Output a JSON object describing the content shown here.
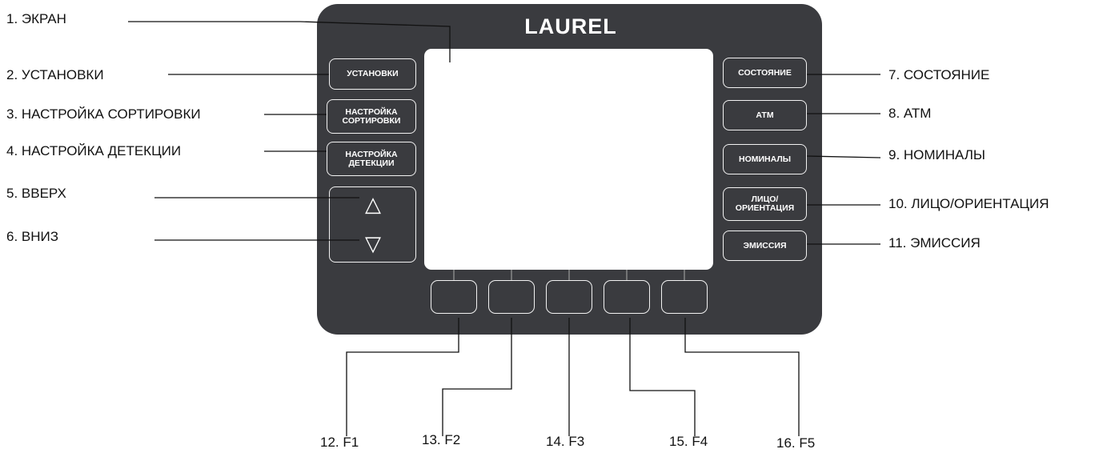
{
  "device": {
    "brand": "LAUREL",
    "left_keys": [
      {
        "id": "setup",
        "label": "УСТАНОВКИ"
      },
      {
        "id": "sort-setup",
        "label": "НАСТРОЙКА\nСОРТИРОВКИ"
      },
      {
        "id": "detect-setup",
        "label": "НАСТРОЙКА\nДЕТЕКЦИИ"
      }
    ],
    "arrows": {
      "up": "△",
      "down": "▽"
    },
    "right_keys": [
      {
        "id": "status",
        "label": "СОСТОЯНИЕ"
      },
      {
        "id": "atm",
        "label": "АТМ"
      },
      {
        "id": "denominations",
        "label": "НОМИНАЛЫ"
      },
      {
        "id": "face-orientation",
        "label": "ЛИЦО/\nОРИЕНТАЦИЯ"
      },
      {
        "id": "issue",
        "label": "ЭМИССИЯ"
      }
    ]
  },
  "callouts": [
    "1. ЭКРАН",
    "2. УСТАНОВКИ",
    "3. НАСТРОЙКА СОРТИРОВКИ",
    "4. НАСТРОЙКА ДЕТЕКЦИИ",
    "5. ВВЕРХ",
    "6. ВНИЗ",
    "7. СОСТОЯНИЕ",
    "8. АТМ",
    "9. НОМИНАЛЫ",
    "10. ЛИЦО/ОРИЕНТАЦИЯ",
    "11. ЭМИССИЯ",
    "12. F1",
    "13. F2",
    "14. F3",
    "15. F4",
    "16. F5"
  ],
  "colors": {
    "panel": "#3a3b3f",
    "key_border": "#f2f2f2",
    "screen": "#ffffff",
    "leader": "#111111"
  }
}
